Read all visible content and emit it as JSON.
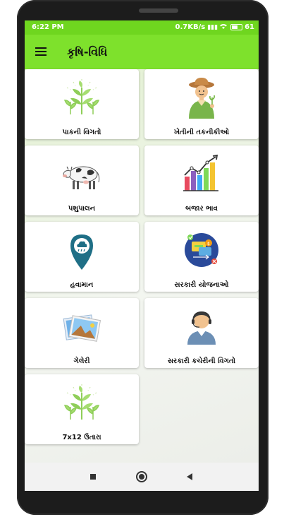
{
  "status": {
    "time": "6:22 PM",
    "network": "0.7KB/s",
    "battery": "61"
  },
  "appbar": {
    "title": "કૃષિ-વિધિ",
    "menu_icon": "hamburger-menu-icon"
  },
  "cards": [
    {
      "label": "પાકની વિગતો",
      "icon": "plant-sprout-icon"
    },
    {
      "label": "ખેતીની તકનીકીઓ",
      "icon": "farmer-icon"
    },
    {
      "label": "પશુપાલન",
      "icon": "cow-icon"
    },
    {
      "label": "બજાર ભાવ",
      "icon": "market-chart-icon"
    },
    {
      "label": "હવામાન",
      "icon": "weather-pin-icon"
    },
    {
      "label": "સરકારી યોજનાઓ",
      "icon": "scheme-transfer-icon"
    },
    {
      "label": "ગેલેરી",
      "icon": "gallery-icon"
    },
    {
      "label": "સરકારી કચેરીની વિગતો",
      "icon": "office-support-icon"
    },
    {
      "label": "7x12 ઉતારા",
      "icon": "plant-sprout-icon"
    }
  ],
  "navbar": {
    "back_icon": "back-triangle-icon",
    "home_icon": "home-circle-icon",
    "recents_icon": "recents-square-icon"
  },
  "colors": {
    "statusbar": "#6fd61f",
    "appbar": "#7ee12c"
  }
}
